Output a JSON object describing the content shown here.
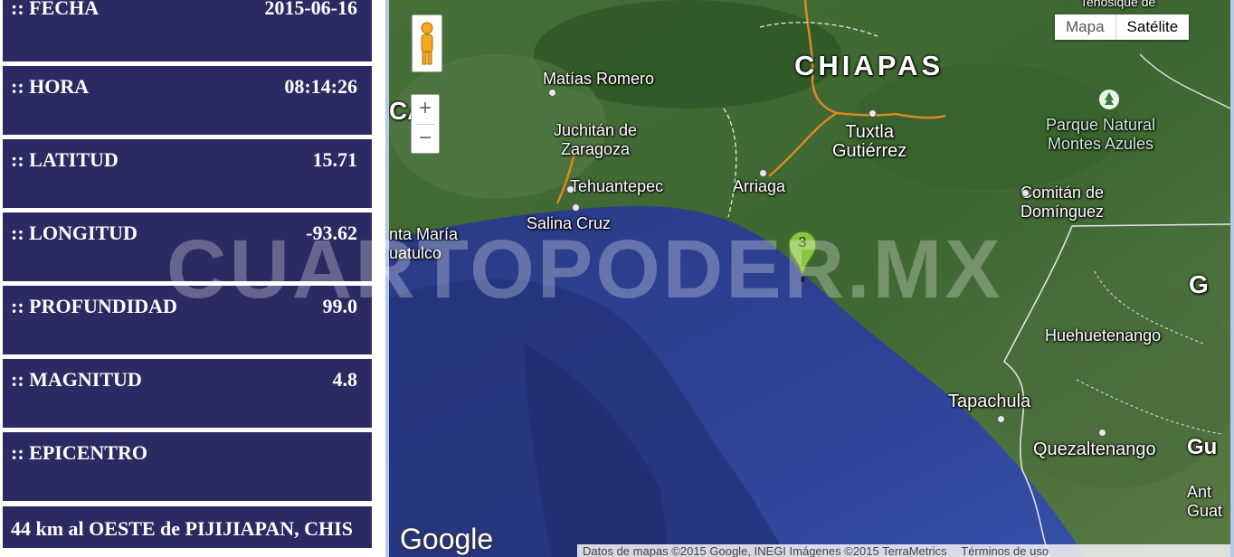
{
  "info": {
    "rows": [
      {
        "label": ":: FECHA",
        "value": "2015-06-16"
      },
      {
        "label": ":: HORA",
        "value": "08:14:26"
      },
      {
        "label": ":: LATITUD",
        "value": "15.71"
      },
      {
        "label": ":: LONGITUD",
        "value": "-93.62"
      },
      {
        "label": ":: PROFUNDIDAD",
        "value": "99.0"
      },
      {
        "label": ":: MAGNITUD",
        "value": "4.8"
      },
      {
        "label": ":: EPICENTRO",
        "value": ""
      }
    ],
    "epicenter_text": "44 km al OESTE de PIJIJIAPAN, CHIS"
  },
  "map": {
    "map_type": {
      "map_label": "Mapa",
      "satellite_label": "Satélite",
      "selected": "Satélite"
    },
    "zoom": {
      "in": "+",
      "out": "−"
    },
    "marker_label": "3",
    "state": "CHIAPAS",
    "places": {
      "matias_romero": "Matías Romero",
      "juchitan": "Juchitán de\nZaragoza",
      "tehuantepec": "Tehuantepec",
      "salina_cruz": "Salina Cruz",
      "santa_maria": "nta María\nuatulco",
      "arriaga": "Arriaga",
      "tuxtla": "Tuxtla\nGutiérrez",
      "comitan": "Comitán de\nDomínguez",
      "huehuetenango": "Huehuetenango",
      "tapachula": "Tapachula",
      "quezaltenango": "Quezaltenango",
      "parque": "Parque Natural\nMontes Azules",
      "tenosique": "Tenosique de",
      "edge_ca": "CA",
      "edge_g": "G",
      "edge_gu": "Gu",
      "edge_ant": "Ant\nGuat"
    },
    "google_logo": "Google",
    "attribution": "Datos de mapas ©2015 Google, INEGI Imágenes ©2015 TerraMetrics",
    "terms": "Términos de uso"
  },
  "watermark": "CUARTOPODER.MX",
  "colors": {
    "panel_row": "#2c2a63",
    "ocean": "#2c3d8c",
    "land": "#3f6a32",
    "marker": "#8bc53f"
  }
}
